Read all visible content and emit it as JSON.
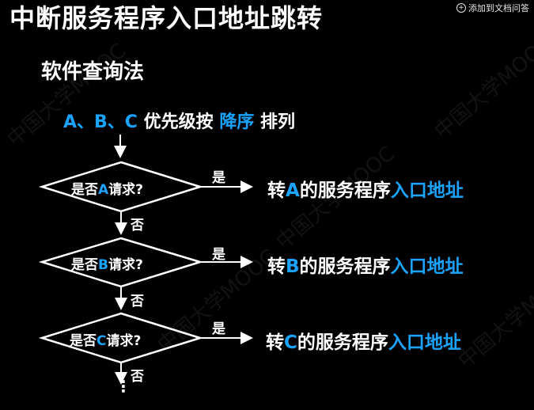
{
  "title": "中断服务程序入口地址跳转",
  "add_to_doc": "添加到文档问答",
  "subtitle": "软件查询法",
  "order": {
    "prefix": "A、B、C",
    "mid": "优先级按",
    "highlight": "降序",
    "suffix": "排列"
  },
  "watermark": "中国大学MOOC",
  "yes_label": "是",
  "no_label": "否",
  "continuation": "⋮",
  "decisions": [
    {
      "pre": "是否",
      "letter": "A",
      "post": "请求?"
    },
    {
      "pre": "是否",
      "letter": "B",
      "post": "请求?"
    },
    {
      "pre": "是否",
      "letter": "C",
      "post": "请求?"
    }
  ],
  "results": [
    {
      "pre": "转",
      "letter": "A",
      "mid": "的服务程序",
      "hl": "入口地址"
    },
    {
      "pre": "转",
      "letter": "B",
      "mid": "的服务程序",
      "hl": "入口地址"
    },
    {
      "pre": "转",
      "letter": "C",
      "mid": "的服务程序",
      "hl": "入口地址"
    }
  ],
  "colors": {
    "highlight": "#1aa3ff",
    "text": "#ffffff",
    "background": "#000000"
  }
}
